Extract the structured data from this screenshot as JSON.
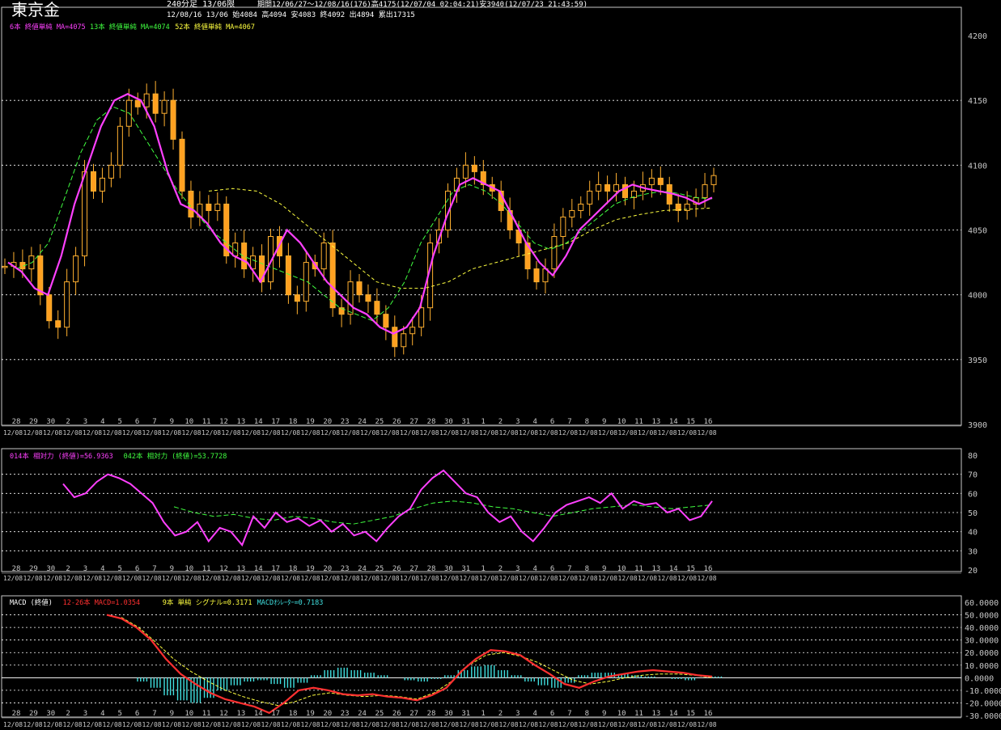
{
  "header": {
    "instrument": "東京金",
    "timeframe": "240分足 13/06限",
    "period_info": "期間12/06/27～12/08/16(176)高4175(12/07/04 02:04:21)安3940(12/07/23 21:43:59)",
    "latest_bar": "12/08/16 13/06 始4084 高4094 安4083 終4092 出4894 累出17315"
  },
  "legends": {
    "price": [
      {
        "text": "6本 終値単純 MA=4075",
        "color": "#ff40ff"
      },
      {
        "text": "13本 終値単純 MA=4074",
        "color": "#40ff40"
      },
      {
        "text": "52本 終値単純 MA=4067",
        "color": "#ffff40"
      }
    ],
    "rsi": [
      {
        "text": "014本 相対力 (終値)=56.9363",
        "color": "#ff40ff"
      },
      {
        "text": "042本 相対力 (終値)=53.7728",
        "color": "#40ff40"
      }
    ],
    "macd": [
      {
        "text": "MACD (終値)",
        "color": "#ffffff"
      },
      {
        "text": "12-26本 MACD=1.0354",
        "color": "#ff3030"
      },
      {
        "text": "9本 単純 シグナル=0.3171",
        "color": "#ffff40"
      },
      {
        "text": "MACDｵｼﾚｰﾀｰ=0.7183",
        "color": "#40e0e0"
      }
    ]
  },
  "chart_data": [
    {
      "type": "candlestick",
      "ylim": [
        3900,
        4200
      ],
      "yticks": [
        3900,
        3950,
        4000,
        4050,
        4100,
        4150,
        4200
      ],
      "x_day_labels": [
        "28",
        "29",
        "30",
        "2",
        "3",
        "4",
        "5",
        "6",
        "7",
        "9",
        "10",
        "11",
        "12",
        "13",
        "14",
        "17",
        "18",
        "19",
        "20",
        "23",
        "24",
        "25",
        "26",
        "27",
        "28",
        "30",
        "31",
        "1",
        "2",
        "3",
        "4",
        "6",
        "7",
        "8",
        "9",
        "10",
        "11",
        "13",
        "14",
        "15",
        "16"
      ],
      "x_month_label": "12/08",
      "ohlc_anchor_closes": [
        4022,
        4025,
        4020,
        4030,
        4000,
        3980,
        3975,
        4010,
        4030,
        4095,
        4080,
        4090,
        4100,
        4130,
        4150,
        4145,
        4155,
        4140,
        4150,
        4120,
        4080,
        4060,
        4070,
        4065,
        4070,
        4030,
        4040,
        4020,
        4030,
        4010,
        4045,
        4030,
        4000,
        3995,
        4025,
        4020,
        4040,
        3990,
        3985,
        4010,
        4000,
        3995,
        3985,
        3975,
        3960,
        3970,
        3975,
        3990,
        4040,
        4050,
        4080,
        4090,
        4100,
        4095,
        4085,
        4080,
        4065,
        4050,
        4040,
        4020,
        4010,
        4020,
        4045,
        4060,
        4065,
        4070,
        4080,
        4085,
        4080,
        4085,
        4075,
        4080,
        4085,
        4090,
        4085,
        4070,
        4065,
        4070,
        4075,
        4085,
        4092
      ],
      "series": [
        {
          "name": "6本 終値単純 MA",
          "color": "#ff40ff",
          "values": [
            4025,
            4018,
            4005,
            4000,
            4030,
            4070,
            4100,
            4130,
            4150,
            4155,
            4150,
            4130,
            4095,
            4070,
            4065,
            4055,
            4040,
            4030,
            4025,
            4010,
            4030,
            4050,
            4040,
            4025,
            4010,
            4000,
            3990,
            3985,
            3975,
            3970,
            3975,
            3990,
            4030,
            4060,
            4085,
            4090,
            4085,
            4080,
            4060,
            4040,
            4025,
            4015,
            4030,
            4050,
            4060,
            4070,
            4080,
            4085,
            4082,
            4080,
            4078,
            4075,
            4070,
            4075
          ]
        },
        {
          "name": "13本 終値単純 MA",
          "color": "#40ff40",
          "values": [
            4020,
            4025,
            4040,
            4075,
            4110,
            4135,
            4145,
            4140,
            4120,
            4100,
            4080,
            4065,
            4050,
            4040,
            4030,
            4025,
            4020,
            4015,
            4010,
            4000,
            3990,
            3985,
            3980,
            3990,
            4010,
            4040,
            4060,
            4080,
            4085,
            4080,
            4070,
            4055,
            4040,
            4035,
            4040,
            4050,
            4060,
            4070,
            4075,
            4078,
            4080,
            4078,
            4075,
            4074
          ]
        },
        {
          "name": "52本 終値単純 MA",
          "color": "#ffff40",
          "values": [
            4080,
            4082,
            4080,
            4070,
            4055,
            4040,
            4025,
            4010,
            4005,
            4005,
            4010,
            4020,
            4025,
            4030,
            4035,
            4040,
            4050,
            4058,
            4062,
            4065,
            4066,
            4067
          ]
        }
      ]
    },
    {
      "type": "line",
      "ylim": [
        20,
        80
      ],
      "yticks": [
        20,
        30,
        40,
        50,
        60,
        70,
        80
      ],
      "series": [
        {
          "name": "014本 相対力 (終値)",
          "color": "#ff40ff",
          "values": [
            65,
            58,
            60,
            66,
            70,
            68,
            65,
            60,
            55,
            45,
            38,
            40,
            45,
            35,
            42,
            40,
            33,
            48,
            42,
            50,
            45,
            47,
            43,
            46,
            40,
            44,
            38,
            40,
            35,
            42,
            48,
            52,
            62,
            68,
            72,
            66,
            60,
            58,
            50,
            45,
            48,
            40,
            35,
            42,
            50,
            54,
            56,
            58,
            55,
            60,
            52,
            56,
            54,
            55,
            50,
            52,
            46,
            48,
            56
          ]
        },
        {
          "name": "042本 相対力 (終値)",
          "color": "#40ff40",
          "values": [
            53,
            50,
            48,
            49,
            47,
            46,
            48,
            47,
            45,
            44,
            46,
            48,
            52,
            55,
            56,
            55,
            53,
            52,
            50,
            48,
            50,
            52,
            53,
            54,
            53,
            52,
            53,
            54
          ]
        }
      ]
    },
    {
      "type": "line+bar",
      "ylim": [
        -30,
        60
      ],
      "yticks": [
        "60.0000",
        "50.0000",
        "40.0000",
        "30.0000",
        "20.0000",
        "10.0000",
        "0.0000",
        "-10.0000",
        "-20.0000",
        "-30.0000"
      ],
      "series": [
        {
          "name": "12-26本 MACD",
          "color": "#ff3030",
          "values": [
            50,
            47,
            40,
            30,
            15,
            3,
            -5,
            -12,
            -17,
            -20,
            -23,
            -28,
            -20,
            -10,
            -8,
            -10,
            -13,
            -14,
            -13,
            -15,
            -16,
            -18,
            -14,
            -8,
            5,
            15,
            22,
            21,
            18,
            10,
            3,
            -5,
            -8,
            -3,
            1,
            3,
            5,
            6,
            5,
            4,
            2,
            1
          ]
        },
        {
          "name": "9本 単純 シグナル",
          "color": "#ffff40",
          "values": [
            48,
            40,
            28,
            15,
            5,
            -3,
            -10,
            -15,
            -19,
            -22,
            -19,
            -14,
            -12,
            -14,
            -15,
            -14,
            -15,
            -17,
            -12,
            -3,
            10,
            18,
            20,
            17,
            12,
            5,
            -2,
            -5,
            -3,
            0,
            2,
            3,
            3,
            2,
            0
          ]
        },
        {
          "name": "MACDｵｼﾚｰﾀｰ",
          "color": "#40e0e0",
          "values": [
            -3,
            -8,
            -14,
            -18,
            -20,
            -16,
            -10,
            -6,
            -3,
            -2,
            -5,
            -8,
            -4,
            2,
            6,
            8,
            6,
            4,
            2,
            0,
            -2,
            -3,
            -1,
            2,
            6,
            9,
            10,
            6,
            2,
            -3,
            -6,
            -8,
            -4,
            2,
            4,
            4,
            3,
            2,
            1,
            0,
            -1,
            -2,
            0,
            1
          ]
        }
      ]
    }
  ]
}
